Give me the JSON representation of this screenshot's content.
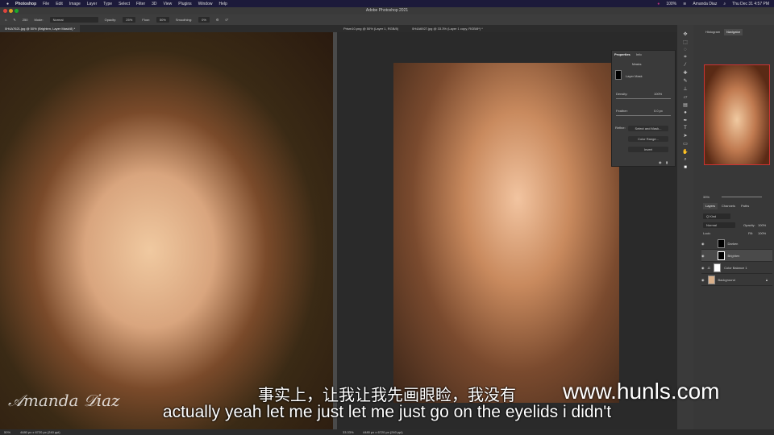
{
  "menubar": {
    "app": "Photoshop",
    "items": [
      "File",
      "Edit",
      "Image",
      "Layer",
      "Type",
      "Select",
      "Filter",
      "3D",
      "View",
      "Plugins",
      "Window",
      "Help"
    ],
    "battery": "100%",
    "user": "Amanda Diaz",
    "datetime": "Thu Dec 31  4:57 PM"
  },
  "window_title": "Adobe Photoshop 2021",
  "options": {
    "brush_size": "250",
    "mode_label": "Mode:",
    "mode": "Normal",
    "opacity_label": "Opacity:",
    "opacity": "25%",
    "flow_label": "Flow:",
    "flow": "50%",
    "smoothing_label": "Smoothing:",
    "smoothing": "0%",
    "angle": "0°"
  },
  "tabs": [
    "0H4A7621.jpg @ 50% (Brighten, Layer Mask/8) *",
    "Prism10.png @ 50% (Layer 1, RGB/8)",
    "0H4A6927.jpg @ 33.3% (Layer 1 copy, RGB/8*) *"
  ],
  "properties": {
    "tabs": [
      "Properties",
      "Info"
    ],
    "masks": "Masks",
    "layer_mask": "Layer Mask",
    "density_label": "Density:",
    "density": "100%",
    "feather_label": "Feather:",
    "feather": "0.0 px",
    "refine": "Refine:",
    "select_mask": "Select and Mask...",
    "color_range": "Color Range...",
    "invert": "Invert"
  },
  "right_panel": {
    "top_tabs": [
      "Histogram",
      "Navigator"
    ],
    "zoom": "33%",
    "layer_tabs": [
      "Layers",
      "Channels",
      "Paths"
    ],
    "kind": "Q Kind",
    "blend": "Normal",
    "opacity_label": "Opacity:",
    "opacity": "100%",
    "lock_label": "Lock:",
    "fill_label": "Fill:",
    "fill": "100%",
    "layers": [
      {
        "name": "Darken"
      },
      {
        "name": "Brighten"
      },
      {
        "name": "Color Balance 1"
      },
      {
        "name": "Background"
      }
    ]
  },
  "bottom": {
    "left_zoom": "50%",
    "left_doc": "4480 px x 6720 px (240 ppi)",
    "right_zoom": "33.33%",
    "right_doc": "4480 px x 6720 px (240 ppi)"
  },
  "subtitles": {
    "chinese": "事实上，让我让我先画眼睑，我没有",
    "english": "actually yeah let me just let me just go on the eyelids i didn't"
  },
  "watermark": "www.hunls.com",
  "signature": "Amanda Diaz"
}
